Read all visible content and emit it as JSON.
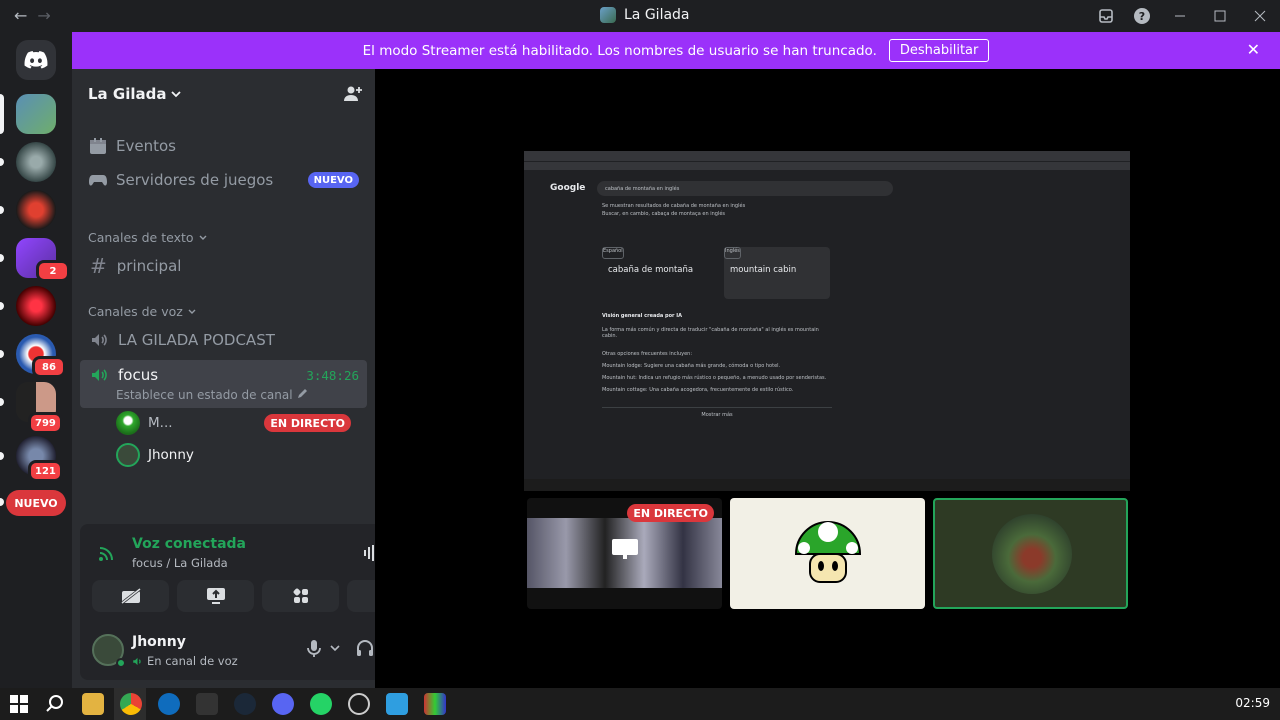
{
  "titlebar": {
    "title": "La Gilada",
    "back": "←",
    "forward": "→"
  },
  "banner": {
    "message": "El modo Streamer está habilitado. Los nombres de usuario se han truncado.",
    "button": "Deshabilitar",
    "close": "✕"
  },
  "guilds": {
    "badges": [
      "2",
      "86",
      "799",
      "121"
    ],
    "new_label": "NUEVO"
  },
  "server": {
    "name": "La Gilada"
  },
  "sidebar": {
    "events": "Eventos",
    "game_servers": "Servidores de juegos",
    "new_badge": "NUEVO",
    "text_category": "Canales de texto",
    "text_channel": "principal",
    "voice_category": "Canales de voz",
    "voice_channel_1": "LA GILADA PODCAST",
    "voice_channel_2": "focus",
    "timer": "3:48:26",
    "channel_status": "Establece un estado de canal",
    "voice_users": [
      {
        "name": "M...",
        "live": "EN DIRECTO"
      },
      {
        "name": "Jhonny"
      }
    ]
  },
  "voice_panel": {
    "title": "Voz conectada",
    "subtitle": "focus / La Gilada"
  },
  "user": {
    "name": "Jhonny",
    "status": "En canal de voz"
  },
  "stream": {
    "search_query": "cabaña de montaña en inglés",
    "showing_results": "Se muestran resultados de cabaña de montaña en inglés",
    "search_instead": "Buscar, en cambio, cabaça de montaça en inglés",
    "source_lang": "Español",
    "target_lang": "Inglés",
    "source_text": "cabaña de montaña",
    "target_text": "mountain cabin",
    "ai_overview_title": "Visión general creada por IA",
    "ai_overview_text": "La forma más común y directa de traducir \"cabaña de montaña\" al inglés es mountain cabin.",
    "other_options": "Otras opciones frecuentes incluyen:",
    "option_1": "Mountain lodge: Sugiere una cabaña más grande, cómoda o tipo hotel.",
    "option_2": "Mountain hut: Indica un refugio más rústico o pequeño, a menudo usado por senderistas.",
    "option_3": "Mountain cottage: Una cabaña acogedora, frecuentemente de estilo rústico.",
    "show_more": "Mostrar más"
  },
  "tiles": {
    "live_label": "EN DIRECTO"
  },
  "clock": "02:59"
}
